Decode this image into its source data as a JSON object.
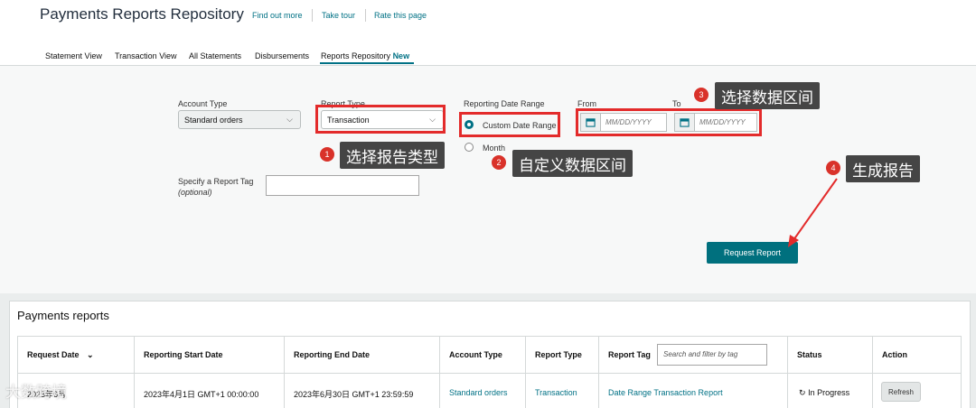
{
  "header": {
    "title": "Payments Reports Repository",
    "links": [
      "Find out more",
      "Take tour",
      "Rate this page"
    ]
  },
  "tabs": [
    {
      "label": "Statement View"
    },
    {
      "label": "Transaction View"
    },
    {
      "label": "All Statements"
    },
    {
      "label": "Disbursements"
    },
    {
      "label": "Reports Repository",
      "badge": "New",
      "active": true
    }
  ],
  "filters": {
    "account_type": {
      "label": "Account Type",
      "value": "Standard orders"
    },
    "report_type": {
      "label": "Report Type",
      "value": "Transaction"
    },
    "date_range": {
      "label": "Reporting Date Range",
      "options": [
        "Custom Date Range",
        "Month"
      ],
      "selected": "Custom Date Range"
    },
    "from": {
      "label": "From",
      "placeholder": "MM/DD/YYYY"
    },
    "to": {
      "label": "To",
      "placeholder": "MM/DD/YYYY"
    },
    "report_tag": {
      "label": "Specify a Report Tag",
      "hint": "(optional)",
      "value": ""
    },
    "request_button": "Request Report"
  },
  "annotations": [
    {
      "num": "1",
      "text": "选择报告类型"
    },
    {
      "num": "2",
      "text": "自定义数据区间"
    },
    {
      "num": "3",
      "text": "选择数据区间"
    },
    {
      "num": "4",
      "text": "生成报告"
    }
  ],
  "reports": {
    "title": "Payments reports",
    "columns": [
      "Request Date",
      "Reporting Start Date",
      "Reporting End Date",
      "Account Type",
      "Report Type",
      "Report Tag",
      "Status",
      "Action"
    ],
    "filter_placeholder": "Search and filter by tag",
    "rows": [
      {
        "request_date": "2023年6月",
        "start": "2023年4月1日 GMT+1 00:00:00",
        "end": "2023年6月30日 GMT+1 23:59:59",
        "account_type": "Standard orders",
        "report_type": "Transaction",
        "report_tag": "Date Range Transaction Report",
        "status": "In Progress",
        "action": "Refresh"
      }
    ]
  },
  "watermark": "大数跨境",
  "colors": {
    "accent": "#007185",
    "button": "#00707e",
    "annotation_red": "#e32b2b"
  }
}
